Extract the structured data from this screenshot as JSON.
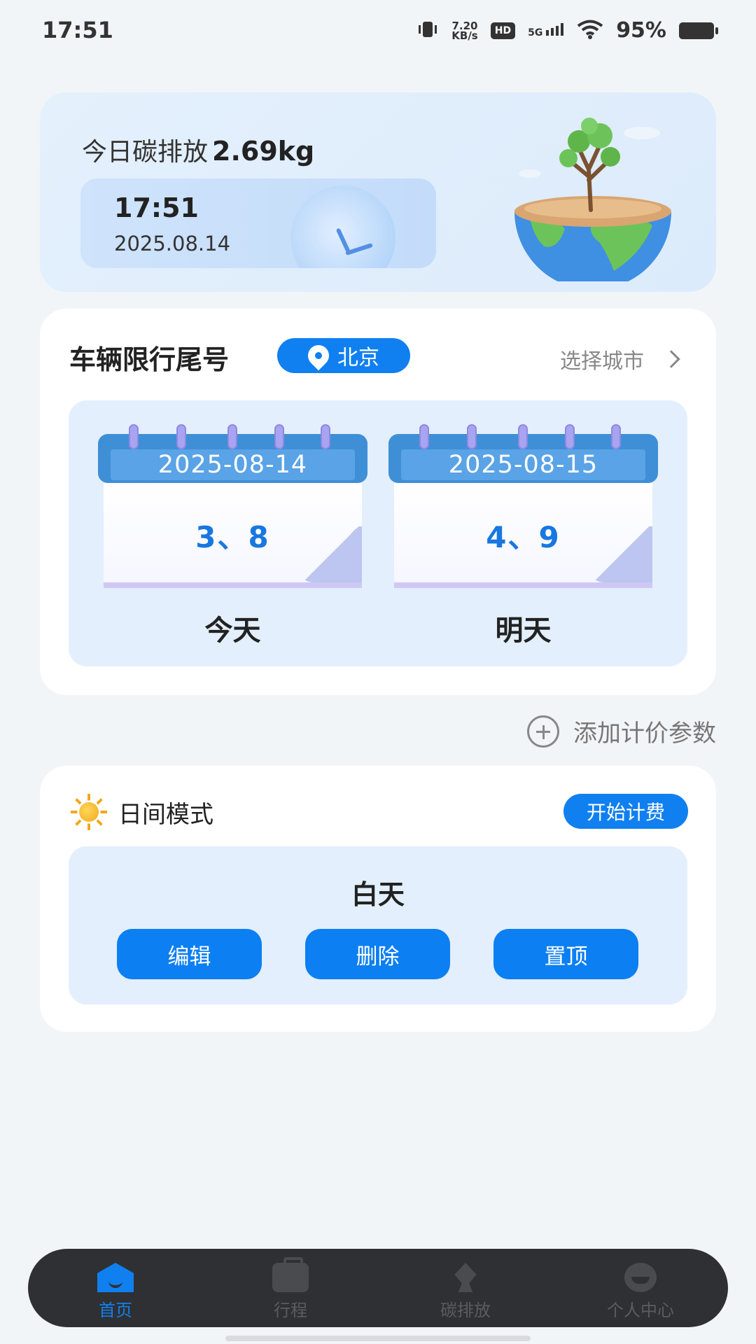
{
  "status_bar": {
    "time": "17:51",
    "net_speed_value": "7.20",
    "net_speed_unit": "KB/s",
    "hd": "HD",
    "signal": "5G",
    "battery_pct": "95%"
  },
  "carbon": {
    "label": "今日碳排放",
    "value": "2.69kg",
    "time": "17:51",
    "date": "2025.08.14"
  },
  "restriction": {
    "title": "车辆限行尾号",
    "city": "北京",
    "choose_city": "选择城市",
    "days": [
      {
        "date": "2025-08-14",
        "numbers": "3、8",
        "label": "今天"
      },
      {
        "date": "2025-08-15",
        "numbers": "4、9",
        "label": "明天"
      }
    ]
  },
  "add_param": {
    "label": "添加计价参数"
  },
  "mode": {
    "title": "日间模式",
    "start_button": "开始计费",
    "name": "白天",
    "buttons": {
      "edit": "编辑",
      "delete": "删除",
      "pin": "置顶"
    }
  },
  "nav": [
    {
      "label": "首页",
      "icon": "home-icon",
      "active": true
    },
    {
      "label": "行程",
      "icon": "briefcase-icon",
      "active": false
    },
    {
      "label": "碳排放",
      "icon": "leaf-icon",
      "active": false
    },
    {
      "label": "个人中心",
      "icon": "profile-icon",
      "active": false
    }
  ],
  "colors": {
    "accent": "#1080f0",
    "nav_bg": "#2f3033",
    "card_tint": "#e3effc"
  }
}
